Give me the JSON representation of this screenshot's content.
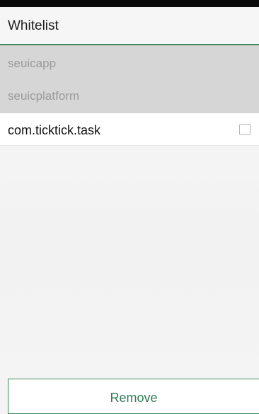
{
  "header": {
    "title": "Whitelist"
  },
  "system_apps": [
    {
      "label": "seuicapp"
    },
    {
      "label": "seuicplatform"
    }
  ],
  "user_apps": [
    {
      "label": "com.ticktick.task",
      "checked": false
    }
  ],
  "actions": {
    "remove_label": "Remove"
  },
  "colors": {
    "accent": "#3e8a5e",
    "system_block_bg": "#d6d6d6",
    "disabled_text": "#9a9a9a"
  }
}
